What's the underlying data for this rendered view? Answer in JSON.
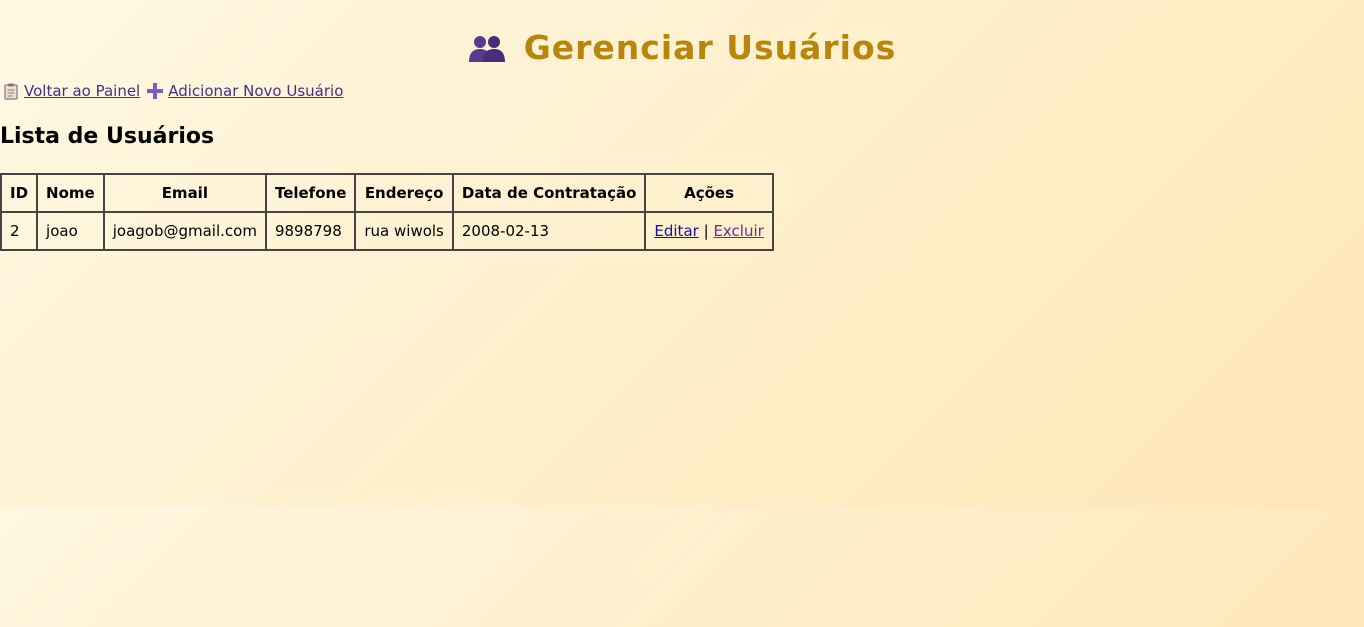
{
  "header": {
    "title": "Gerenciar Usuários",
    "icon": "users-icon",
    "title_color": "#b8860b"
  },
  "nav": {
    "back_label": "Voltar ao Painel",
    "back_icon": "clipboard-icon",
    "add_label": "Adicionar Novo Usuário",
    "add_icon": "plus-icon",
    "link_color": "#4a2c8a"
  },
  "section": {
    "title": "Lista de Usuários"
  },
  "table": {
    "columns": [
      "ID",
      "Nome",
      "Email",
      "Telefone",
      "Endereço",
      "Data de Contratação",
      "Ações"
    ],
    "rows": [
      {
        "id": "2",
        "nome": "joao",
        "email": "joagob@gmail.com",
        "telefone": "9898798",
        "endereco": "rua wiwols",
        "data": "2008-02-13",
        "edit_label": "Editar",
        "separator": "|",
        "delete_label": "Excluir"
      }
    ]
  }
}
